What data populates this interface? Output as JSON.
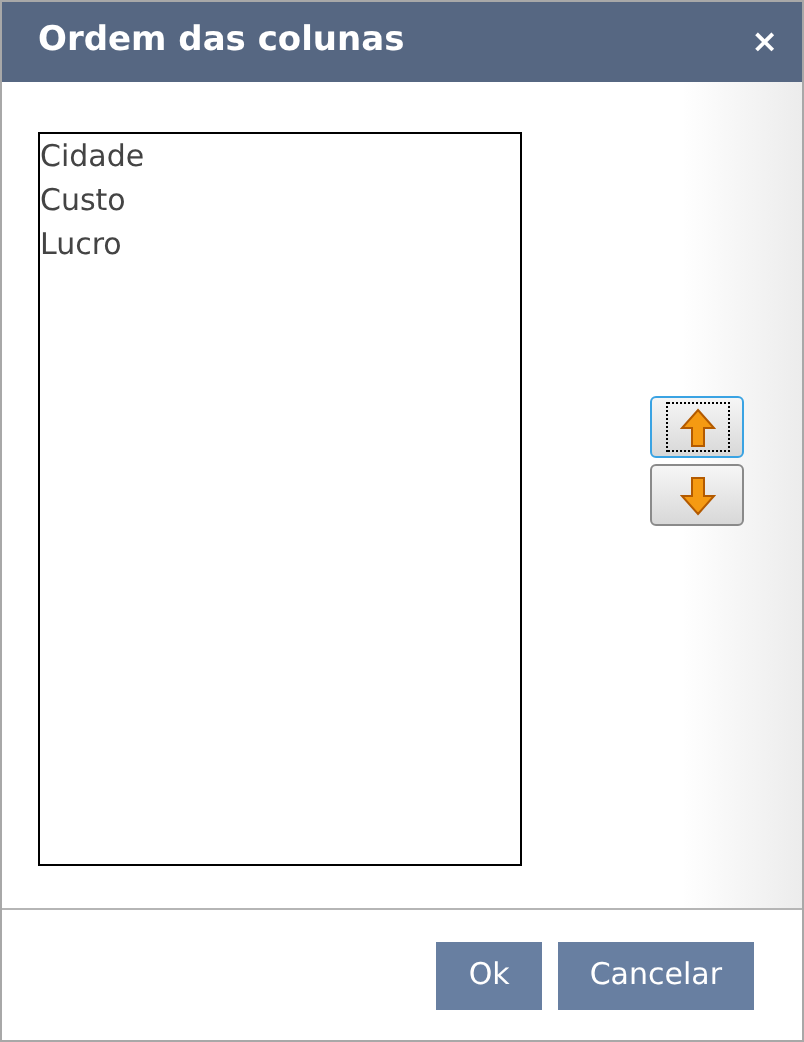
{
  "window": {
    "title": "Ordem das colunas",
    "close": "×"
  },
  "columns": [
    {
      "label": "Cidade",
      "selected": false
    },
    {
      "label": "Custo",
      "selected": false
    },
    {
      "label": "Lucro",
      "selected": false
    }
  ],
  "move_buttons": [
    {
      "kind": "up",
      "focused": true
    },
    {
      "kind": "down",
      "focused": false
    }
  ],
  "buttons": [
    "Ok",
    "Cancelar"
  ]
}
